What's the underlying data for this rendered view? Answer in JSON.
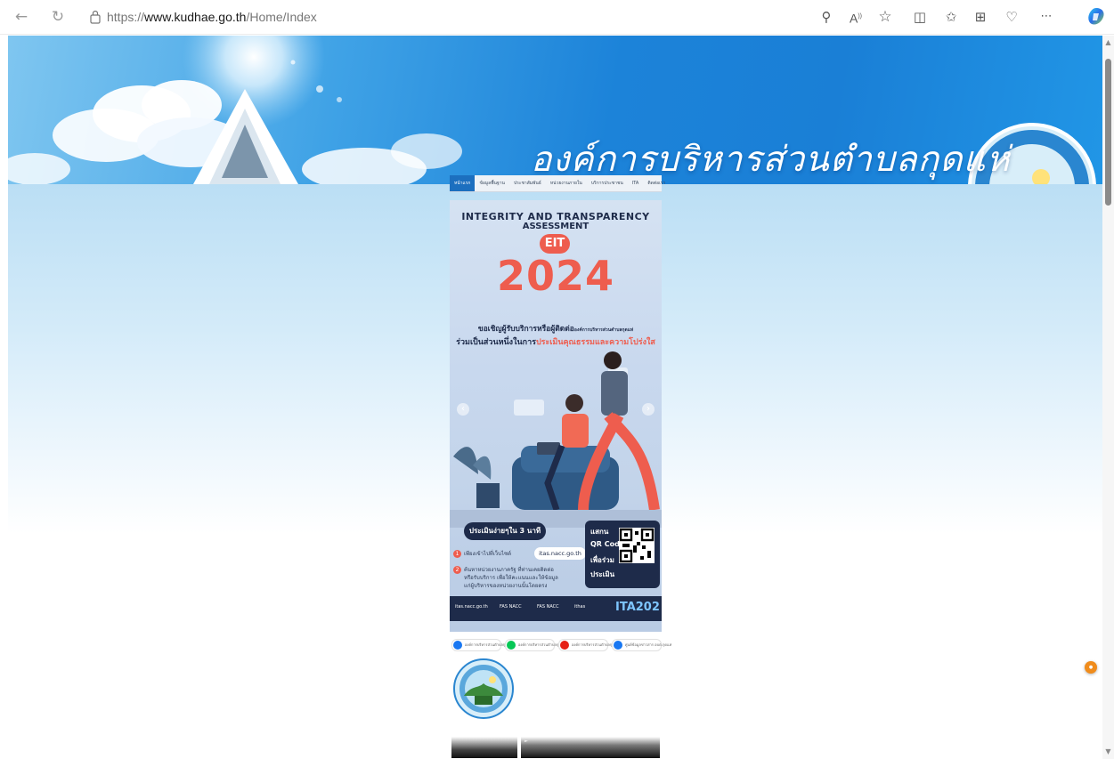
{
  "browser": {
    "url_prefix": "https://",
    "url_domain": "www.kudhae.go.th",
    "url_path": "/Home/Index",
    "icons": [
      "back-icon",
      "refresh-icon",
      "site-info-icon",
      "zoom-icon",
      "read-aloud-icon",
      "favorite-icon",
      "split-screen-icon",
      "favorites-icon",
      "collections-icon",
      "browser-essentials-icon",
      "more-icon",
      "copilot-icon"
    ]
  },
  "site": {
    "banner_title": "องค์การบริหารส่วนตำบลกุดแห่",
    "nav": [
      {
        "label": "หน้าแรก",
        "active": true
      },
      {
        "label": "ข้อมูลพื้นฐาน"
      },
      {
        "label": "ประชาสัมพันธ์"
      },
      {
        "label": "หน่วยงานภายใน"
      },
      {
        "label": "บริการประชาชน"
      },
      {
        "label": "ITA"
      },
      {
        "label": "ติดต่อเรา"
      }
    ]
  },
  "poster": {
    "heading1": "INTEGRITY AND TRANSPARENCY",
    "heading2": "ASSESSMENT",
    "badge": "EIT",
    "year": "2024",
    "line1": "ขอเชิญผู้รับบริการหรือผู้ติดต่อ",
    "line1_org": "องค์การบริหารส่วนตำบลกุดแห่",
    "line2_a": "ร่วมเป็นส่วนหนึ่งในการ",
    "line2_b": "ประเมินคุณธรรมและความโปร่งใส",
    "steps_title": "ประเมินง่ายๆใน 3 นาที",
    "step1": "เพียงเข้าไปที่เว็บไซต์",
    "step1_site": "itas.nacc.go.th",
    "step2a": "ค้นหาหน่วยงานภาครัฐ ที่ท่านเคยติดต่อ",
    "step2b": "หรือรับบริการ เพื่อให้คะแนนและให้ข้อมูล",
    "step2c": "แก่ผู้บริหารของหน่วยงานนั้นโดยตรง",
    "qr_lines": [
      "แสกน",
      "QR Code",
      "เพื่อร่วม",
      "ประเมิน"
    ],
    "footer_items": [
      "itas.nacc.go.th",
      "FAS NACC",
      "FAS NACC",
      "ithas"
    ],
    "footer_brand": "ITA202"
  },
  "social": [
    {
      "label": "องค์การบริหารส่วนตำบลกุดแห่",
      "color": "#1877f2"
    },
    {
      "label": "องค์การบริหารส่วนตำบลกุดแห่",
      "color": "#06c755"
    },
    {
      "label": "องค์การบริหารส่วนตำบลกุดแห่",
      "color": "#e62117"
    },
    {
      "label": "ศูนย์ข้อมูลข่าวสาร อบต.กุดแห่",
      "color": "#1877f2"
    }
  ],
  "colors": {
    "accent": "#ee5d4e",
    "navy": "#1e2b4a",
    "banner_blue": "#1c83d9",
    "nav_active": "#1c6fbf"
  }
}
